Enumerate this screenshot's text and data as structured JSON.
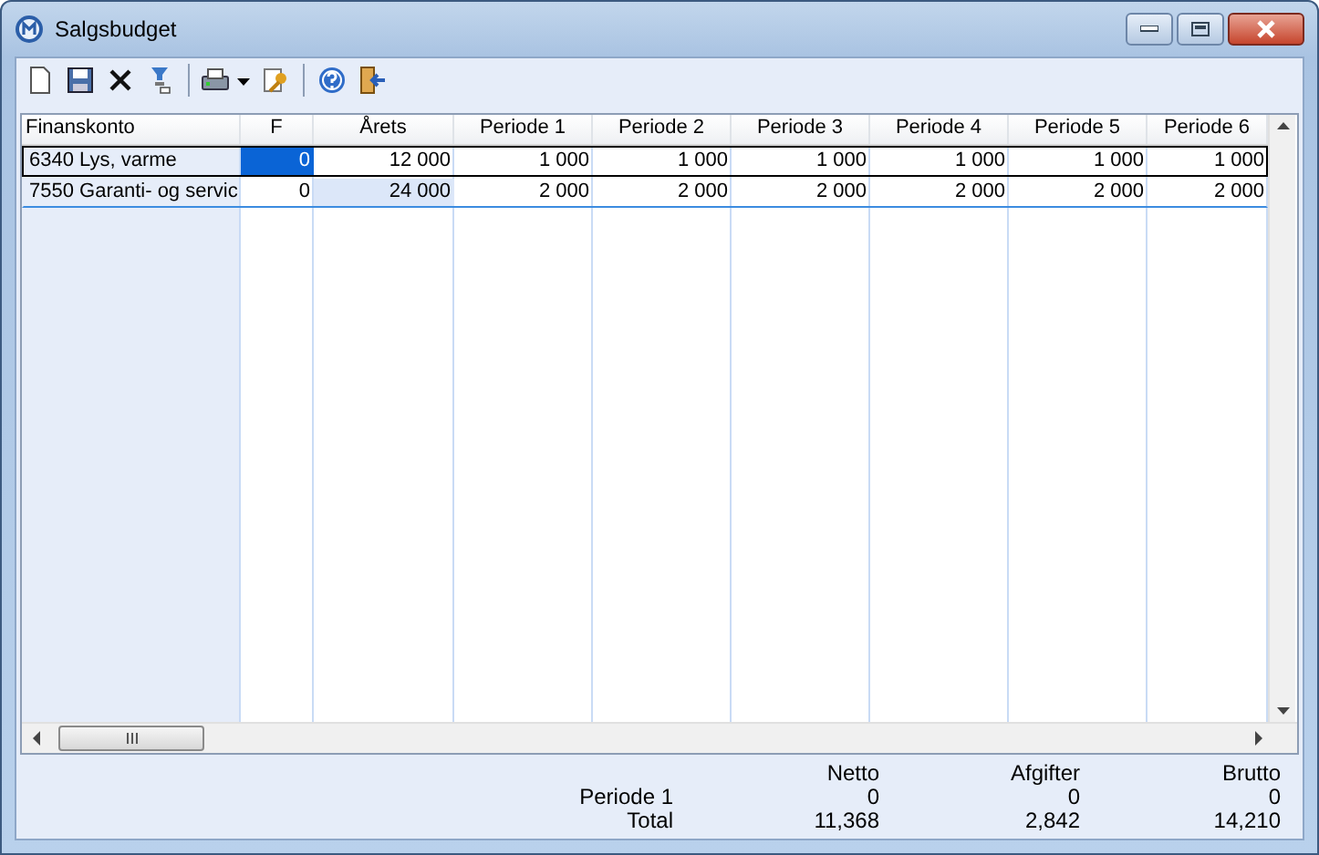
{
  "window": {
    "title": "Salgsbudget"
  },
  "table": {
    "columns": [
      "Finanskonto",
      "F",
      "Årets",
      "Periode 1",
      "Periode 2",
      "Periode 3",
      "Periode 4",
      "Periode 5",
      "Periode 6"
    ],
    "rows": [
      {
        "account": "6340 Lys, varme",
        "selected": true,
        "values": [
          {
            "text": "0",
            "focused": true,
            "shaded": false
          },
          {
            "text": "12 000",
            "focused": false,
            "shaded": false
          },
          {
            "text": "1 000",
            "focused": false,
            "shaded": false
          },
          {
            "text": "1 000",
            "focused": false,
            "shaded": false
          },
          {
            "text": "1 000",
            "focused": false,
            "shaded": false
          },
          {
            "text": "1 000",
            "focused": false,
            "shaded": false
          },
          {
            "text": "1 000",
            "focused": false,
            "shaded": false
          },
          {
            "text": "1 000",
            "focused": false,
            "shaded": false
          }
        ]
      },
      {
        "account": "7550 Garanti- og servic",
        "selected": false,
        "values": [
          {
            "text": "0",
            "focused": false,
            "shaded": false
          },
          {
            "text": "24 000",
            "focused": false,
            "shaded": true
          },
          {
            "text": "2 000",
            "focused": false,
            "shaded": false
          },
          {
            "text": "2 000",
            "focused": false,
            "shaded": false
          },
          {
            "text": "2 000",
            "focused": false,
            "shaded": false
          },
          {
            "text": "2 000",
            "focused": false,
            "shaded": false
          },
          {
            "text": "2 000",
            "focused": false,
            "shaded": false
          },
          {
            "text": "2 000",
            "focused": false,
            "shaded": false
          }
        ]
      }
    ]
  },
  "summary": {
    "columns": [
      "Netto",
      "Afgifter",
      "Brutto"
    ],
    "rows": [
      {
        "label": "Periode 1",
        "values": [
          "0",
          "0",
          "0"
        ]
      },
      {
        "label": "Total",
        "values": [
          "11,368",
          "2,842",
          "14,210"
        ]
      }
    ]
  }
}
